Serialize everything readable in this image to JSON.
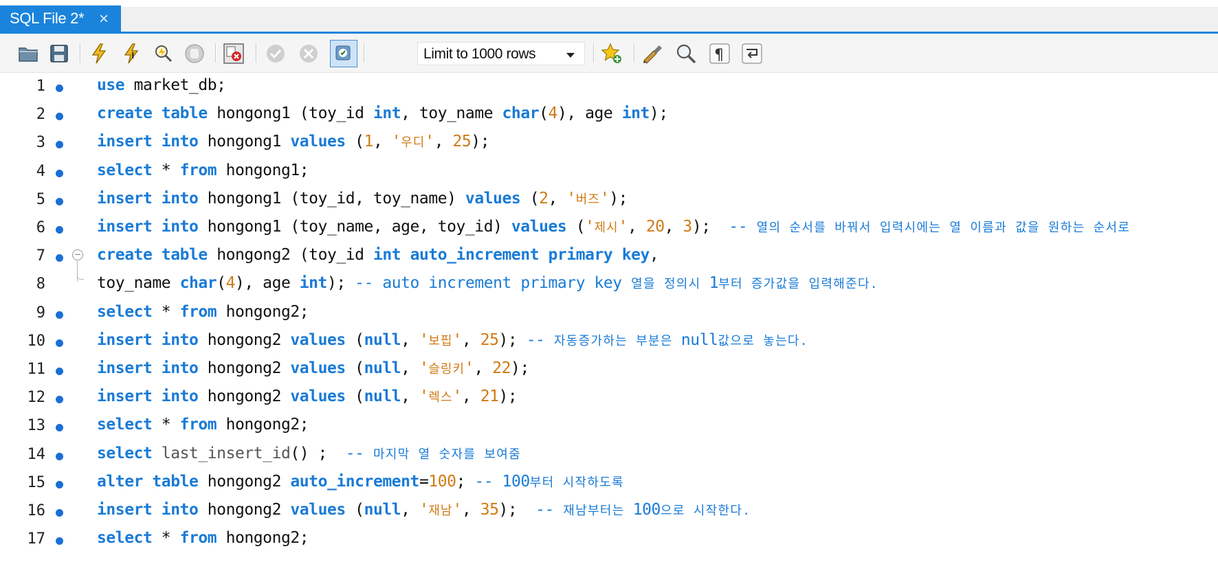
{
  "tab": {
    "title": "SQL File 2*",
    "close_glyph": "×"
  },
  "toolbar": {
    "icons": [
      "open-folder-icon",
      "save-icon",
      "execute-icon",
      "execute-current-icon",
      "explain-icon",
      "stop-icon",
      "toggle-error-icon",
      "commit-icon",
      "rollback-icon",
      "autocommit-icon",
      "bookmark-icon",
      "beautify-icon",
      "find-icon",
      "invisible-chars-icon",
      "word-wrap-icon"
    ],
    "limit_select": {
      "value": "Limit to 1000 rows"
    }
  },
  "editor": {
    "colors": {
      "keyword": "#1a7bd6",
      "number": "#d07a15",
      "string": "#d07a15",
      "comment": "#1a7bd6",
      "breakpoint_dot": "#1a6fd6"
    },
    "lines": [
      {
        "n": "1",
        "dot": true,
        "tokens": [
          [
            "kw",
            "use"
          ],
          [
            "t",
            " market_db;"
          ]
        ]
      },
      {
        "n": "2",
        "dot": true,
        "tokens": [
          [
            "kw",
            "create"
          ],
          [
            "t",
            " "
          ],
          [
            "kw",
            "table"
          ],
          [
            "t",
            " hongong1 (toy_id "
          ],
          [
            "kw",
            "int"
          ],
          [
            "t",
            ", toy_name "
          ],
          [
            "kw",
            "char"
          ],
          [
            "t",
            "("
          ],
          [
            "num",
            "4"
          ],
          [
            "t",
            "), age "
          ],
          [
            "kw",
            "int"
          ],
          [
            "t",
            ");"
          ]
        ]
      },
      {
        "n": "3",
        "dot": true,
        "tokens": [
          [
            "kw",
            "insert"
          ],
          [
            "t",
            " "
          ],
          [
            "kw",
            "into"
          ],
          [
            "t",
            " hongong1 "
          ],
          [
            "kw",
            "values"
          ],
          [
            "t",
            " ("
          ],
          [
            "num",
            "1"
          ],
          [
            "t",
            ", "
          ],
          [
            "str",
            "'"
          ],
          [
            "strk",
            "우디"
          ],
          [
            "str",
            "'"
          ],
          [
            "t",
            ", "
          ],
          [
            "num",
            "25"
          ],
          [
            "t",
            ");"
          ]
        ]
      },
      {
        "n": "4",
        "dot": true,
        "tokens": [
          [
            "kw",
            "select"
          ],
          [
            "t",
            " * "
          ],
          [
            "kw",
            "from"
          ],
          [
            "t",
            " hongong1;"
          ]
        ]
      },
      {
        "n": "5",
        "dot": true,
        "tokens": [
          [
            "kw",
            "insert"
          ],
          [
            "t",
            " "
          ],
          [
            "kw",
            "into"
          ],
          [
            "t",
            " hongong1 (toy_id, toy_name) "
          ],
          [
            "kw",
            "values"
          ],
          [
            "t",
            " ("
          ],
          [
            "num",
            "2"
          ],
          [
            "t",
            ", "
          ],
          [
            "str",
            "'"
          ],
          [
            "strk",
            "버즈"
          ],
          [
            "str",
            "'"
          ],
          [
            "t",
            ");"
          ]
        ]
      },
      {
        "n": "6",
        "dot": true,
        "tokens": [
          [
            "kw",
            "insert"
          ],
          [
            "t",
            " "
          ],
          [
            "kw",
            "into"
          ],
          [
            "t",
            " hongong1 (toy_name, age, toy_id) "
          ],
          [
            "kw",
            "values"
          ],
          [
            "t",
            " ("
          ],
          [
            "str",
            "'"
          ],
          [
            "strk",
            "제시"
          ],
          [
            "str",
            "'"
          ],
          [
            "t",
            ", "
          ],
          [
            "num",
            "20"
          ],
          [
            "t",
            ", "
          ],
          [
            "num",
            "3"
          ],
          [
            "t",
            ");  "
          ],
          [
            "cm",
            "-- "
          ],
          [
            "cmk",
            "열의 순서를 바꿔서 입력시에는 열 이름과 값을 원하는 순서로"
          ]
        ]
      },
      {
        "n": "7",
        "dot": true,
        "fold": "start",
        "tokens": [
          [
            "kw",
            "create"
          ],
          [
            "t",
            " "
          ],
          [
            "kw",
            "table"
          ],
          [
            "t",
            " hongong2 (toy_id "
          ],
          [
            "kw",
            "int"
          ],
          [
            "t",
            " "
          ],
          [
            "kw",
            "auto_increment"
          ],
          [
            "t",
            " "
          ],
          [
            "kw",
            "primary"
          ],
          [
            "t",
            " "
          ],
          [
            "kw",
            "key"
          ],
          [
            "t",
            ","
          ]
        ]
      },
      {
        "n": "8",
        "dot": false,
        "fold": "end",
        "tokens": [
          [
            "t",
            "toy_name "
          ],
          [
            "kw",
            "char"
          ],
          [
            "t",
            "("
          ],
          [
            "num",
            "4"
          ],
          [
            "t",
            "), age "
          ],
          [
            "kw",
            "int"
          ],
          [
            "t",
            "); "
          ],
          [
            "cm",
            "-- auto increment primary key "
          ],
          [
            "cmk",
            "열을 정의시 "
          ],
          [
            "cm",
            "1"
          ],
          [
            "cmk",
            "부터 증가값을 입력해준다."
          ]
        ]
      },
      {
        "n": "9",
        "dot": true,
        "tokens": [
          [
            "kw",
            "select"
          ],
          [
            "t",
            " * "
          ],
          [
            "kw",
            "from"
          ],
          [
            "t",
            " hongong2;"
          ]
        ]
      },
      {
        "n": "10",
        "dot": true,
        "tokens": [
          [
            "kw",
            "insert"
          ],
          [
            "t",
            " "
          ],
          [
            "kw",
            "into"
          ],
          [
            "t",
            " hongong2 "
          ],
          [
            "kw",
            "values"
          ],
          [
            "t",
            " ("
          ],
          [
            "kw",
            "null"
          ],
          [
            "t",
            ", "
          ],
          [
            "str",
            "'"
          ],
          [
            "strk",
            "보핍"
          ],
          [
            "str",
            "'"
          ],
          [
            "t",
            ", "
          ],
          [
            "num",
            "25"
          ],
          [
            "t",
            "); "
          ],
          [
            "cm",
            "-- "
          ],
          [
            "cmk",
            "자동증가하는 부분은 "
          ],
          [
            "cm",
            "null"
          ],
          [
            "cmk",
            "값으로 놓는다."
          ]
        ]
      },
      {
        "n": "11",
        "dot": true,
        "tokens": [
          [
            "kw",
            "insert"
          ],
          [
            "t",
            " "
          ],
          [
            "kw",
            "into"
          ],
          [
            "t",
            " hongong2 "
          ],
          [
            "kw",
            "values"
          ],
          [
            "t",
            " ("
          ],
          [
            "kw",
            "null"
          ],
          [
            "t",
            ", "
          ],
          [
            "str",
            "'"
          ],
          [
            "strk",
            "슬링키"
          ],
          [
            "str",
            "'"
          ],
          [
            "t",
            ", "
          ],
          [
            "num",
            "22"
          ],
          [
            "t",
            ");"
          ]
        ]
      },
      {
        "n": "12",
        "dot": true,
        "tokens": [
          [
            "kw",
            "insert"
          ],
          [
            "t",
            " "
          ],
          [
            "kw",
            "into"
          ],
          [
            "t",
            " hongong2 "
          ],
          [
            "kw",
            "values"
          ],
          [
            "t",
            " ("
          ],
          [
            "kw",
            "null"
          ],
          [
            "t",
            ", "
          ],
          [
            "str",
            "'"
          ],
          [
            "strk",
            "렉스"
          ],
          [
            "str",
            "'"
          ],
          [
            "t",
            ", "
          ],
          [
            "num",
            "21"
          ],
          [
            "t",
            ");"
          ]
        ]
      },
      {
        "n": "13",
        "dot": true,
        "tokens": [
          [
            "kw",
            "select"
          ],
          [
            "t",
            " * "
          ],
          [
            "kw",
            "from"
          ],
          [
            "t",
            " hongong2;"
          ]
        ]
      },
      {
        "n": "14",
        "dot": true,
        "tokens": [
          [
            "kw",
            "select"
          ],
          [
            "t",
            " "
          ],
          [
            "fn",
            "last_insert_id"
          ],
          [
            "t",
            "() ;  "
          ],
          [
            "cm",
            "-- "
          ],
          [
            "cmk",
            "마지막 열 숫자를 보여줌"
          ]
        ]
      },
      {
        "n": "15",
        "dot": true,
        "tokens": [
          [
            "kw",
            "alter"
          ],
          [
            "t",
            " "
          ],
          [
            "kw",
            "table"
          ],
          [
            "t",
            " hongong2 "
          ],
          [
            "kw",
            "auto_increment"
          ],
          [
            "t",
            "="
          ],
          [
            "num",
            "100"
          ],
          [
            "t",
            "; "
          ],
          [
            "cm",
            "-- 100"
          ],
          [
            "cmk",
            "부터 시작하도록"
          ]
        ]
      },
      {
        "n": "16",
        "dot": true,
        "tokens": [
          [
            "kw",
            "insert"
          ],
          [
            "t",
            " "
          ],
          [
            "kw",
            "into"
          ],
          [
            "t",
            " hongong2 "
          ],
          [
            "kw",
            "values"
          ],
          [
            "t",
            " ("
          ],
          [
            "kw",
            "null"
          ],
          [
            "t",
            ", "
          ],
          [
            "str",
            "'"
          ],
          [
            "strk",
            "재남"
          ],
          [
            "str",
            "'"
          ],
          [
            "t",
            ", "
          ],
          [
            "num",
            "35"
          ],
          [
            "t",
            ");  "
          ],
          [
            "cm",
            "-- "
          ],
          [
            "cmk",
            "재남부터는 "
          ],
          [
            "cm",
            "100"
          ],
          [
            "cmk",
            "으로 시작한다."
          ]
        ]
      },
      {
        "n": "17",
        "dot": true,
        "tokens": [
          [
            "kw",
            "select"
          ],
          [
            "t",
            " * "
          ],
          [
            "kw",
            "from"
          ],
          [
            "t",
            " hongong2;"
          ]
        ]
      }
    ]
  }
}
